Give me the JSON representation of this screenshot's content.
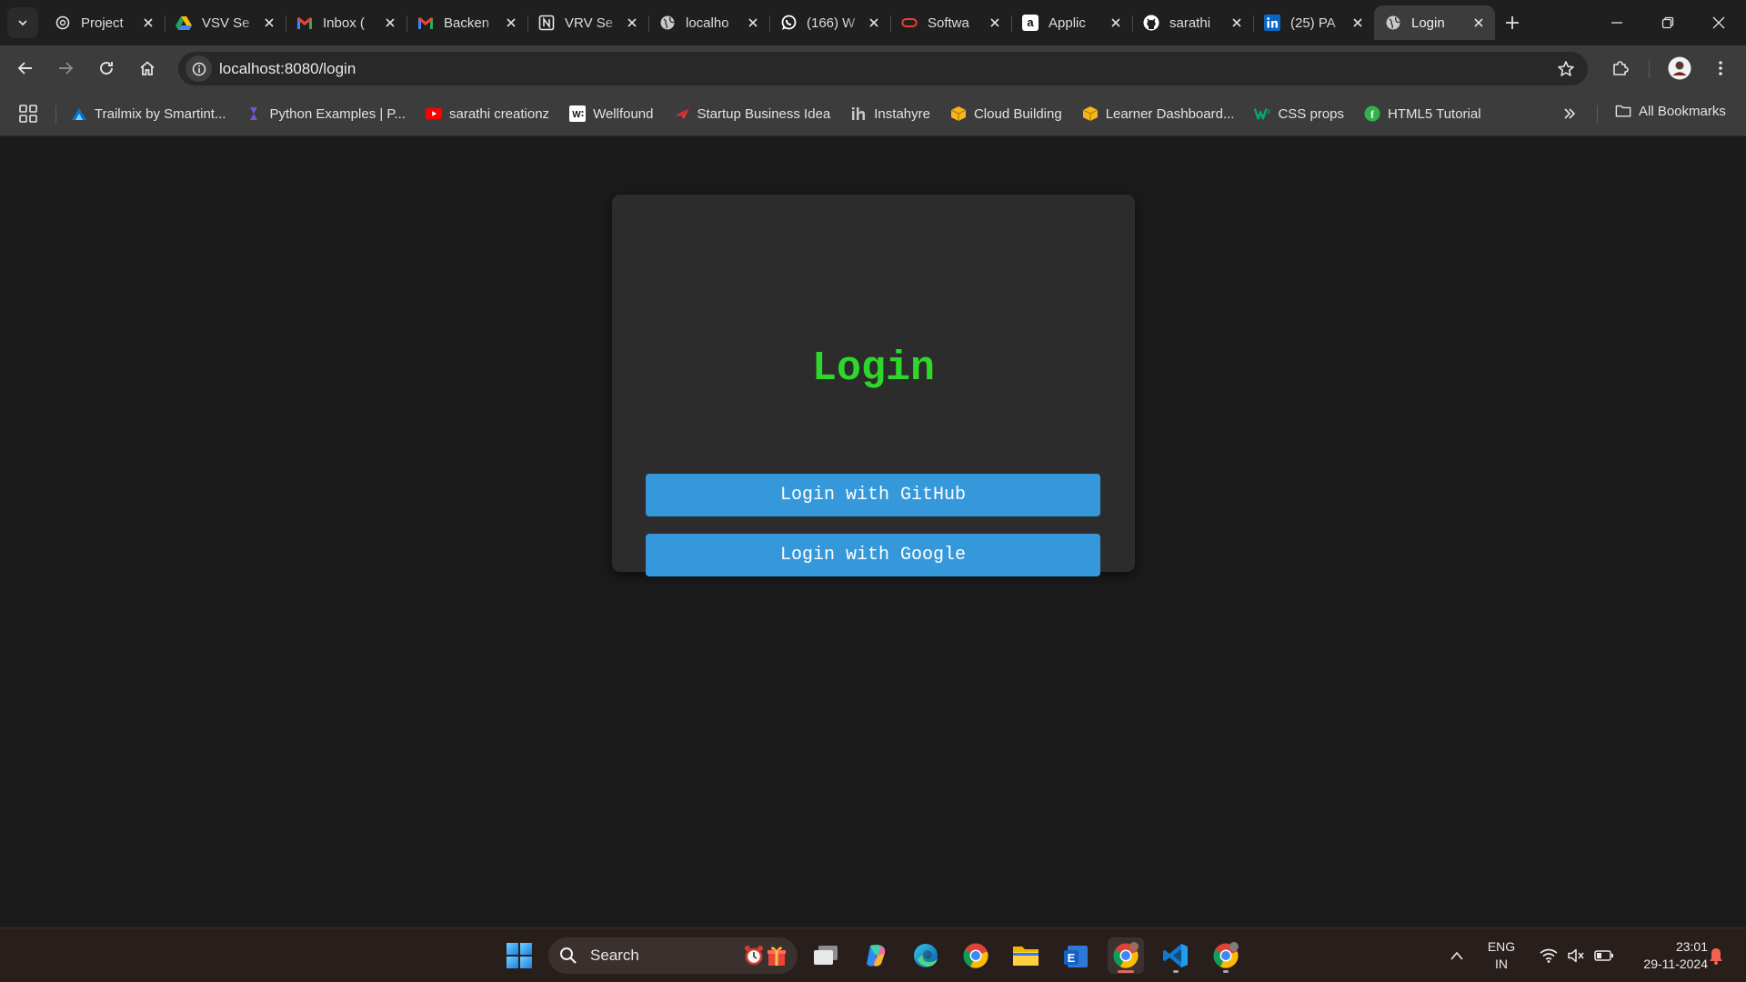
{
  "tabs": [
    {
      "title": "Project",
      "icon": "openai-icon",
      "active": false
    },
    {
      "title": "VSV Se",
      "icon": "google-drive-icon",
      "active": false
    },
    {
      "title": "Inbox (",
      "icon": "gmail-icon",
      "active": false
    },
    {
      "title": "Backen",
      "icon": "gmail-icon",
      "active": false
    },
    {
      "title": "VRV Se",
      "icon": "notion-icon",
      "active": false
    },
    {
      "title": "localho",
      "icon": "globe-icon",
      "active": false
    },
    {
      "title": "(166) W",
      "icon": "whatsapp-icon",
      "active": false
    },
    {
      "title": "Softwa",
      "icon": "oracle-icon",
      "active": false
    },
    {
      "title": "Applic",
      "icon": "amazon-icon",
      "active": false
    },
    {
      "title": "sarathi",
      "icon": "github-icon",
      "active": false
    },
    {
      "title": "(25) PA",
      "icon": "linkedin-icon",
      "active": false
    },
    {
      "title": "Login",
      "icon": "globe-icon",
      "active": true
    }
  ],
  "address_bar": {
    "url": "localhost:8080/login"
  },
  "bookmarks": [
    {
      "label": "Trailmix by Smartint...",
      "icon": "trailhead-icon"
    },
    {
      "label": "Python Examples | P...",
      "icon": "python-examples-icon"
    },
    {
      "label": "sarathi creationz",
      "icon": "youtube-icon"
    },
    {
      "label": "Wellfound",
      "icon": "wellfound-icon"
    },
    {
      "label": "Startup Business Idea",
      "icon": "paper-plane-icon"
    },
    {
      "label": "Instahyre",
      "icon": "instahyre-icon"
    },
    {
      "label": "Cloud Building",
      "icon": "package-icon"
    },
    {
      "label": "Learner Dashboard...",
      "icon": "package-icon"
    },
    {
      "label": "CSS props",
      "icon": "w3schools-icon"
    },
    {
      "label": "HTML5 Tutorial",
      "icon": "html5-tutorial-icon"
    }
  ],
  "all_bookmarks_label": "All Bookmarks",
  "login": {
    "title": "Login",
    "github_button": "Login with GitHub",
    "google_button": "Login with Google"
  },
  "colors": {
    "title_green": "#2ed82a",
    "button_blue": "#3498db",
    "card_bg": "#2c2c2c",
    "page_bg": "#1b1b1b"
  },
  "taskbar": {
    "search_label": "Search",
    "language": {
      "line1": "ENG",
      "line2": "IN"
    },
    "time": "23:01",
    "date": "29-11-2024"
  }
}
